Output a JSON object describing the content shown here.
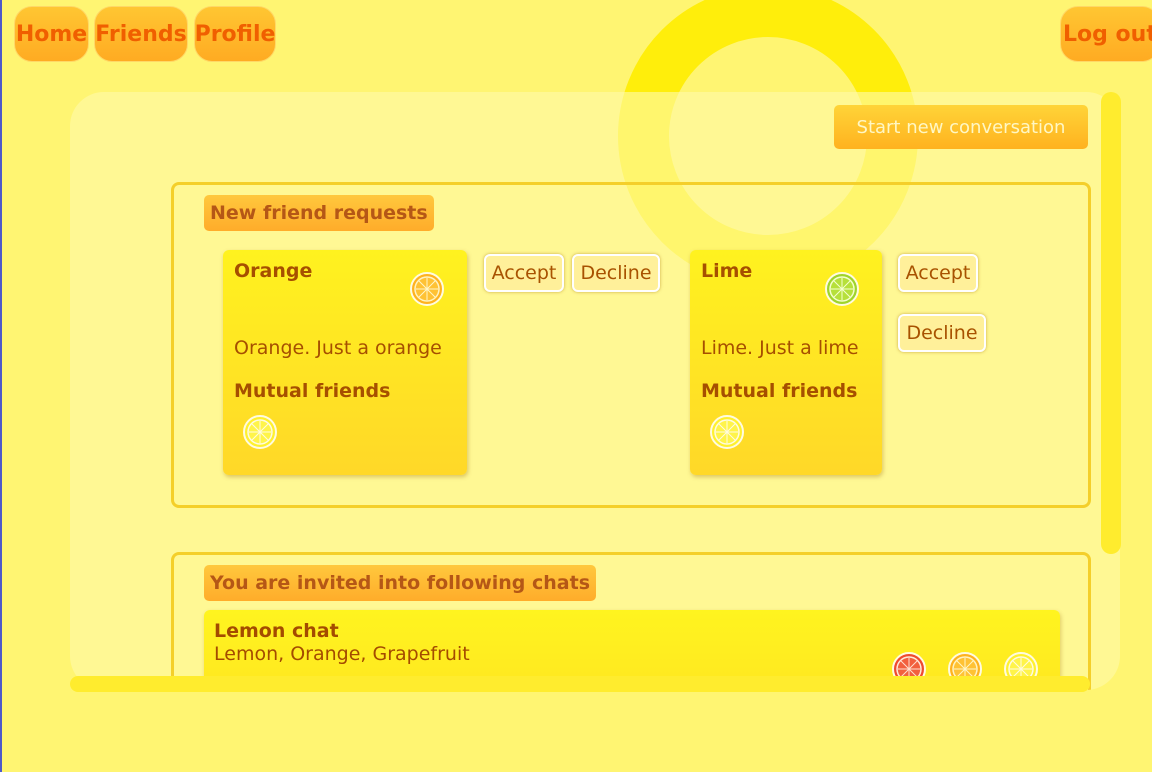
{
  "nav": {
    "home": "Home",
    "friends": "Friends",
    "profile": "Profile",
    "logout": "Log out"
  },
  "main": {
    "start_conversation": "Start new conversation",
    "friend_requests": {
      "title": "New friend requests",
      "requests": [
        {
          "name": "Orange",
          "avatar": "orange-slice-icon",
          "description": "Orange. Just a orange",
          "mutual_label": "Mutual friends",
          "mutual_friends": [
            "lemon-slice-icon"
          ],
          "accept": "Accept",
          "decline": "Decline"
        },
        {
          "name": "Lime",
          "avatar": "lime-slice-icon",
          "description": "Lime. Just a lime",
          "mutual_label": "Mutual friends",
          "mutual_friends": [
            "lemon-slice-icon"
          ],
          "accept": "Accept",
          "decline": "Decline"
        }
      ]
    },
    "invites": {
      "title": "You are invited into following chats",
      "chats": [
        {
          "name": "Lemon chat",
          "members": "Lemon, Orange, Grapefruit",
          "member_icons": [
            "grapefruit-slice-icon",
            "orange-slice-icon",
            "lemon-slice-icon"
          ]
        }
      ]
    }
  },
  "colors": {
    "background": "#fff572",
    "nav_text": "#f05f00",
    "card_text": "#a64f00",
    "accent_orange": "#ffb21f",
    "border_yellow": "#f4cf2a"
  }
}
